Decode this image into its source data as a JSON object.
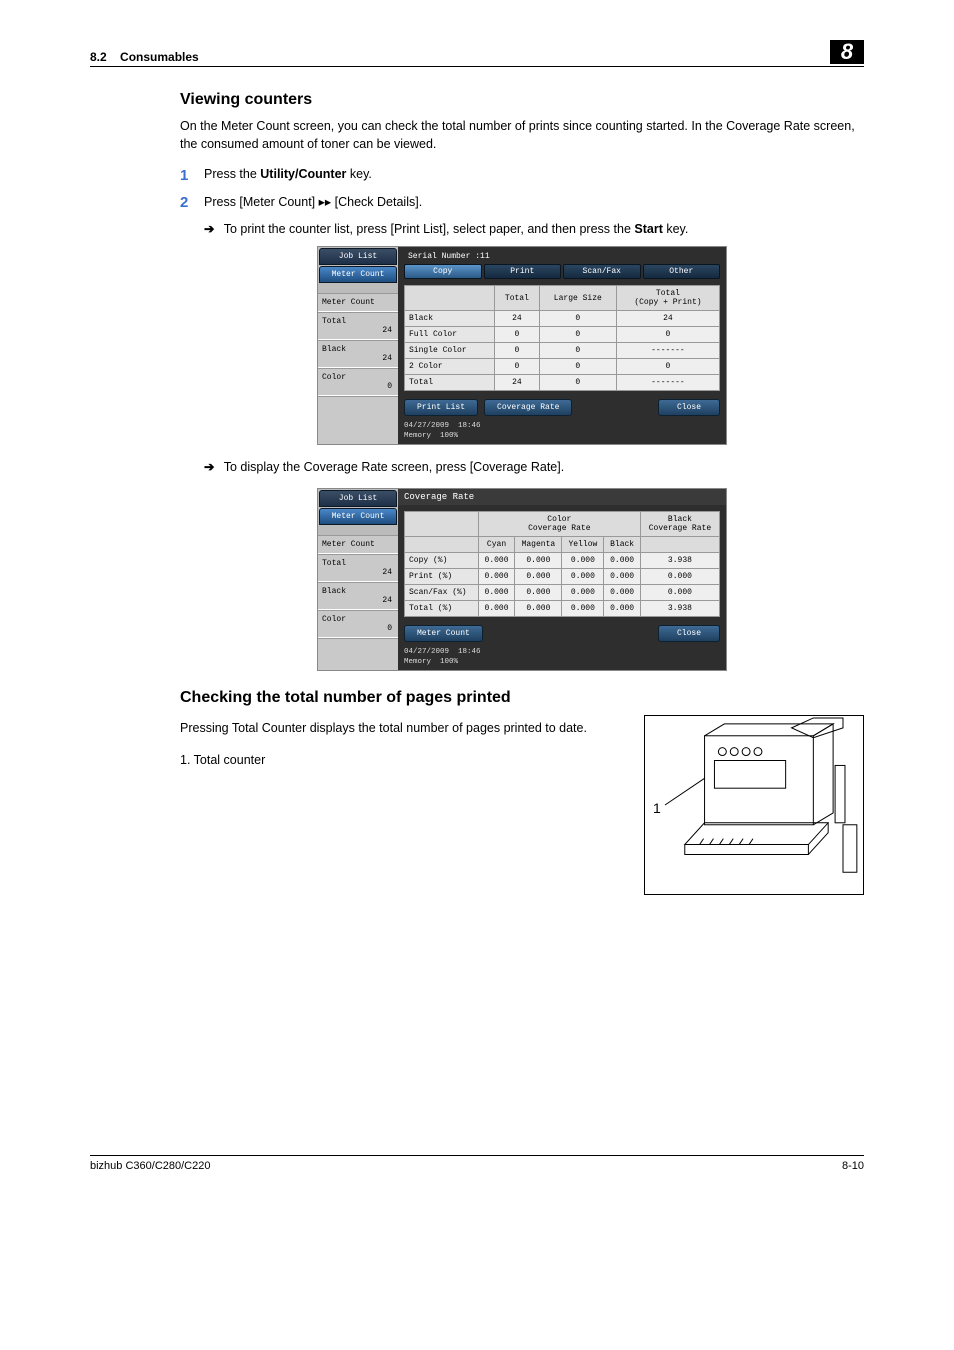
{
  "header": {
    "section_no": "8.2",
    "section_title": "Consumables",
    "chapter": "8"
  },
  "h_viewing": "Viewing counters",
  "p_viewing": "On the Meter Count screen, you can check the total number of prints since counting started. In the Coverage Rate screen, the consumed amount of toner can be viewed.",
  "step1_pre": "Press the ",
  "step1_bold": "Utility/Counter",
  "step1_post": " key.",
  "step2": "Press [Meter Count] ▸▸ [Check Details].",
  "sub_print_pre": "To print the counter list, press [Print List], select paper, and then press the ",
  "sub_print_bold": "Start",
  "sub_print_post": " key.",
  "sub_cov": "To display the Coverage Rate screen, press [Coverage Rate].",
  "h_checking": "Checking the total number of pages printed",
  "p_checking": "Pressing Total Counter displays the total number of pages printed to date.",
  "list_item_1": "1. Total counter",
  "printer_callout": "1",
  "footer": {
    "left": "bizhub C360/C280/C220",
    "right": "8-10"
  },
  "lcd_common": {
    "left_tab_job": "Job List",
    "left_tab_meter": "Meter Count",
    "meter_count": "Meter Count",
    "total_lbl": "Total",
    "total_val": "24",
    "black_lbl": "Black",
    "black_val": "24",
    "color_lbl": "Color",
    "color_val": "0",
    "date": "04/27/2009",
    "time": "18:46",
    "mem_lbl": "Memory",
    "mem_val": "100%",
    "close": "Close"
  },
  "lcd1": {
    "serial": "Serial Number      :11",
    "tabs": [
      "Copy",
      "Print",
      "Scan/Fax",
      "Other"
    ],
    "cols": [
      "",
      "Total",
      "Large Size",
      "Total\n(Copy + Print)"
    ],
    "rows": [
      {
        "label": "Black",
        "v": [
          "24",
          "0",
          "24"
        ]
      },
      {
        "label": "Full Color",
        "v": [
          "0",
          "0",
          "0"
        ]
      },
      {
        "label": "Single Color",
        "v": [
          "0",
          "0",
          "-------"
        ]
      },
      {
        "label": "2 Color",
        "v": [
          "0",
          "0",
          "0"
        ]
      },
      {
        "label": "Total",
        "v": [
          "24",
          "0",
          "-------"
        ]
      }
    ],
    "btn_print": "Print List",
    "btn_cov": "Coverage Rate"
  },
  "lcd2": {
    "title": "Coverage Rate",
    "grp_color": "Color\nCoverage Rate",
    "grp_black": "Black\nCoverage Rate",
    "cols": [
      "",
      "Cyan",
      "Magenta",
      "Yellow",
      "Black",
      ""
    ],
    "rows": [
      {
        "label": "Copy (%)",
        "v": [
          "0.000",
          "0.000",
          "0.000",
          "0.000",
          "3.938"
        ]
      },
      {
        "label": "Print (%)",
        "v": [
          "0.000",
          "0.000",
          "0.000",
          "0.000",
          "0.000"
        ]
      },
      {
        "label": "Scan/Fax (%)",
        "v": [
          "0.000",
          "0.000",
          "0.000",
          "0.000",
          "0.000"
        ]
      },
      {
        "label": "Total (%)",
        "v": [
          "0.000",
          "0.000",
          "0.000",
          "0.000",
          "3.938"
        ]
      }
    ],
    "btn_meter": "Meter Count"
  }
}
